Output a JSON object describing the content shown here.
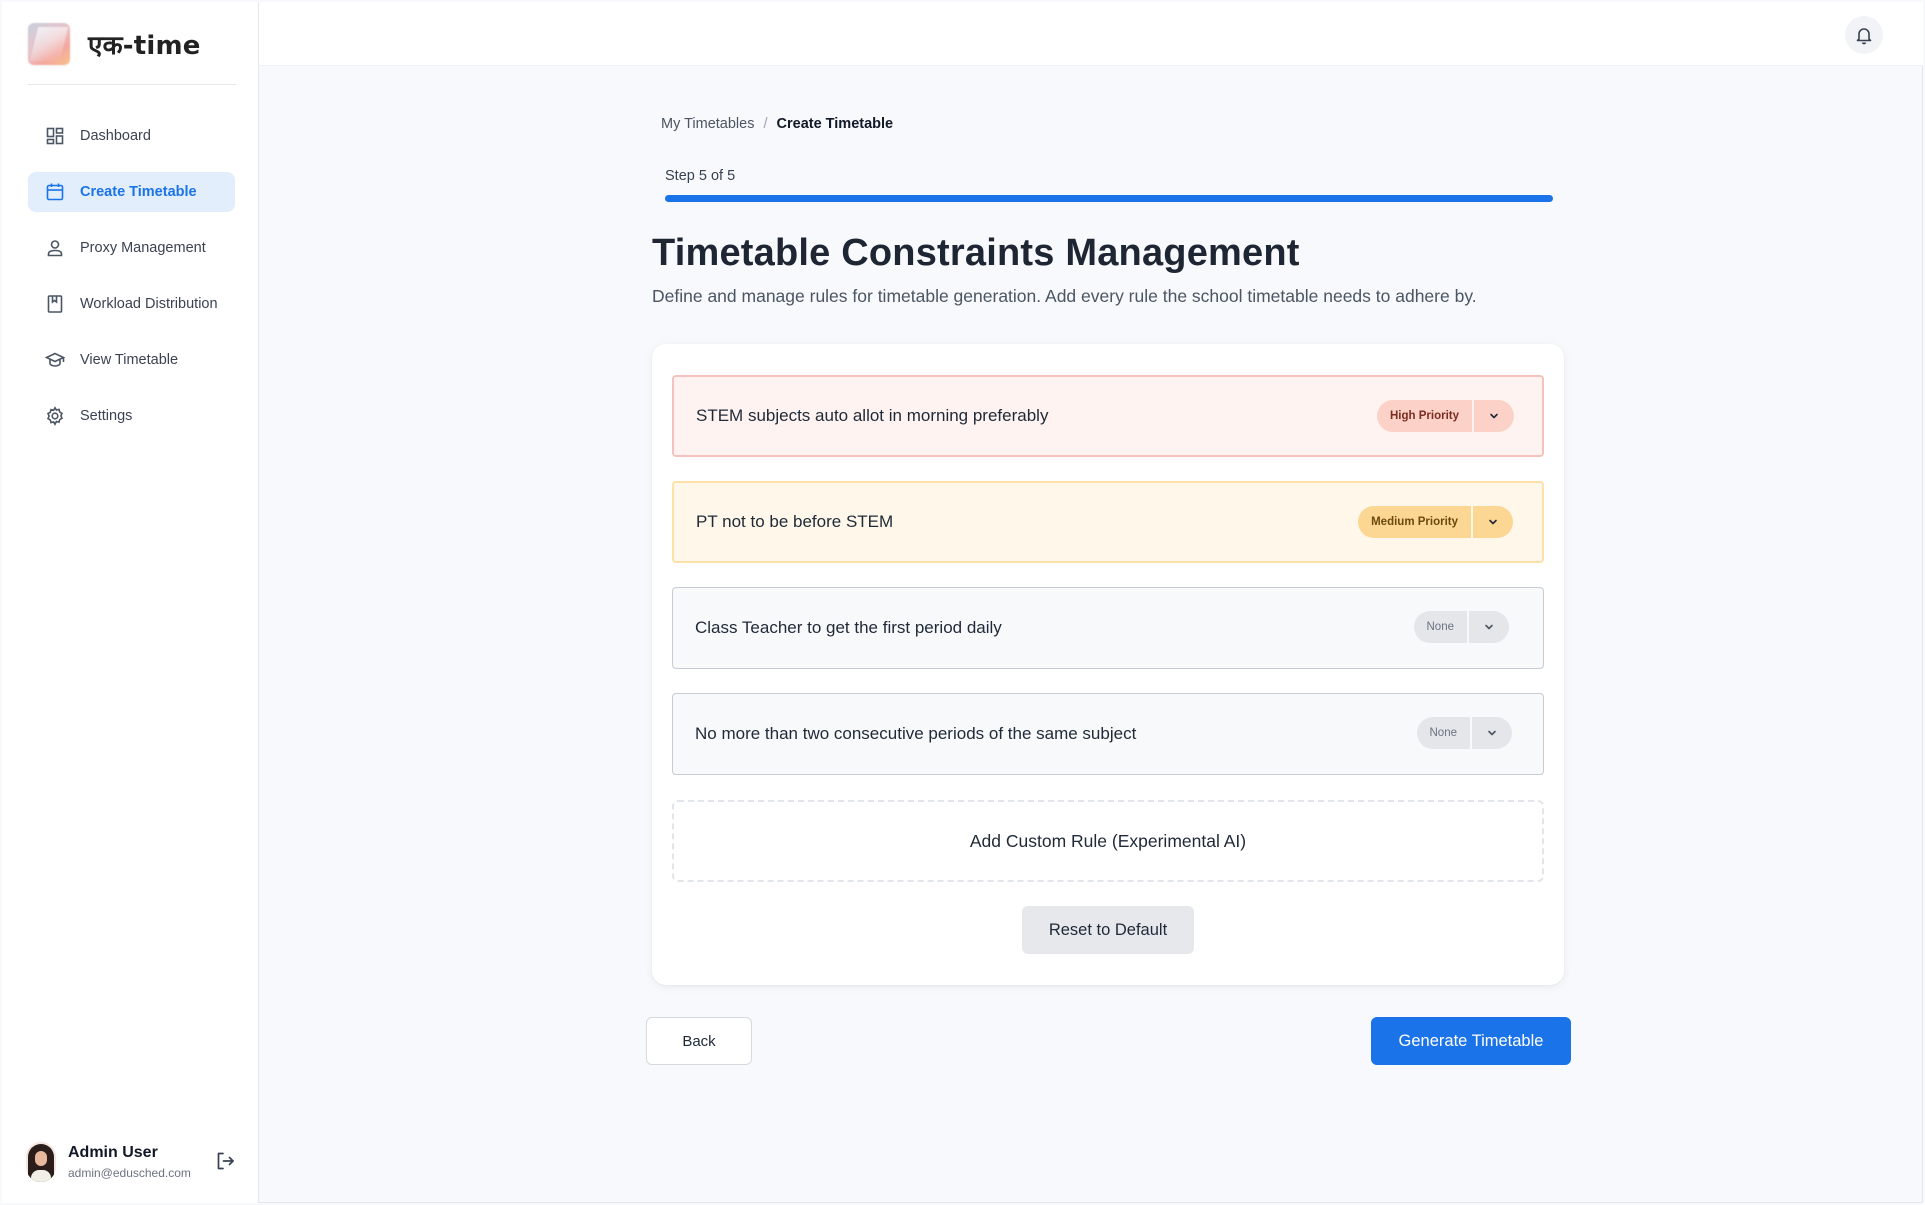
{
  "brand": {
    "name": "एक-time"
  },
  "sidebar": {
    "items": [
      {
        "label": "Dashboard",
        "icon": "dashboard-icon",
        "active": false
      },
      {
        "label": "Create Timetable",
        "icon": "calendar-icon",
        "active": true
      },
      {
        "label": "Proxy Management",
        "icon": "user-icon",
        "active": false
      },
      {
        "label": "Workload Distribution",
        "icon": "bookmark-icon",
        "active": false
      },
      {
        "label": "View Timetable",
        "icon": "graduation-cap-icon",
        "active": false
      },
      {
        "label": "Settings",
        "icon": "gear-icon",
        "active": false
      }
    ],
    "user": {
      "name": "Admin User",
      "email": "admin@edusched.com"
    }
  },
  "breadcrumb": {
    "parent": "My Timetables",
    "separator": "/",
    "current": "Create Timetable"
  },
  "progress": {
    "label": "Step 5 of 5",
    "fraction": 1.0
  },
  "page": {
    "title": "Timetable Constraints Management",
    "subtitle": "Define and manage rules for timetable generation. Add every rule the school timetable needs to adhere by."
  },
  "rules": [
    {
      "text": "STEM subjects auto allot in morning preferably",
      "priority": "High Priority",
      "level": "high"
    },
    {
      "text": "PT not to be before STEM",
      "priority": "Medium Priority",
      "level": "medium"
    },
    {
      "text": "Class Teacher to get the first period daily",
      "priority": "None",
      "level": "none"
    },
    {
      "text": "No more than two consecutive periods of the same subject",
      "priority": "None",
      "level": "none"
    }
  ],
  "actions": {
    "add_rule": "Add Custom Rule (Experimental AI)",
    "reset": "Reset to Default",
    "back": "Back",
    "generate": "Generate Timetable"
  },
  "colors": {
    "accent": "#1a73e8",
    "high_bg": "#fff3f1",
    "medium_bg": "#fff8ea",
    "none_bg": "#f8f9fb"
  }
}
